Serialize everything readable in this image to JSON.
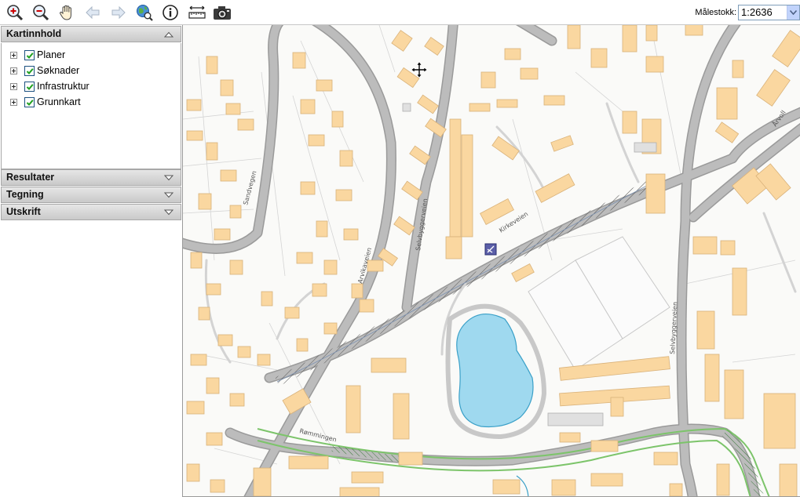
{
  "toolbar": {
    "tools": [
      "zoom-in-icon",
      "zoom-out-icon",
      "pan-hand-icon",
      "back-arrow-icon",
      "forward-arrow-icon",
      "globe-search-icon",
      "info-icon",
      "measure-icon",
      "camera-icon"
    ],
    "scale_label": "Målestokk:",
    "scale_value": "1:2636"
  },
  "sidebar": {
    "content_title": "Kartinnhold",
    "layers": [
      {
        "label": "Planer",
        "checked": true
      },
      {
        "label": "Søknader",
        "checked": true
      },
      {
        "label": "Infrastruktur",
        "checked": true
      },
      {
        "label": "Grunnkart",
        "checked": true
      }
    ],
    "panels": [
      "Resultater",
      "Tegning",
      "Utskrift"
    ]
  },
  "map": {
    "street_names": [
      "Sandvegen",
      "Arvikaveien",
      "Selvbyggerveien",
      "Kirkeveien",
      "Selvbyggerveien",
      "Rømmingen",
      "Årvoll"
    ],
    "colors": {
      "building": "#fad7a0",
      "building_stroke": "#d9b27a",
      "road": "#b9b9b9",
      "road_outline": "#9a9a9a",
      "water": "#9fd9ef",
      "water_stroke": "#3aa0c8",
      "plan_green": "#7cc46a",
      "background": "#fafaf8"
    }
  }
}
